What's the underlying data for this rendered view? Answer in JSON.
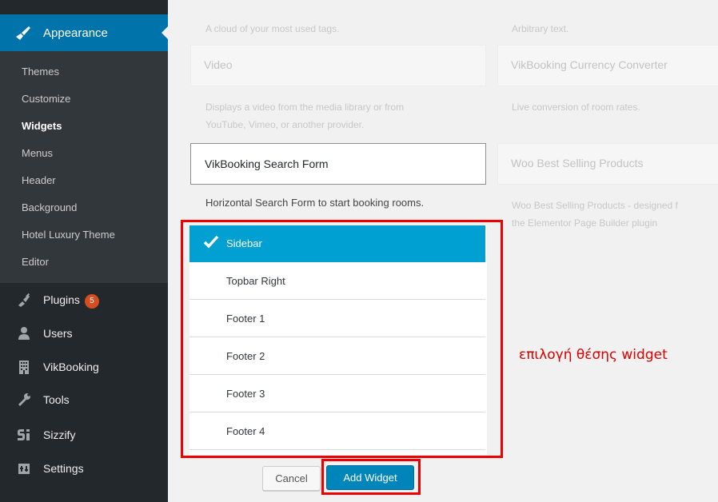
{
  "sidebar": {
    "appearance_label": "Appearance",
    "submenu": [
      "Themes",
      "Customize",
      "Widgets",
      "Menus",
      "Header",
      "Background",
      "Hotel Luxury Theme",
      "Editor"
    ],
    "active_submenu": "Widgets",
    "menu": {
      "plugins": {
        "label": "Plugins",
        "badge": "5"
      },
      "users": "Users",
      "vikbooking": "VikBooking",
      "tools": "Tools",
      "sizzify": "Sizzify",
      "settings": "Settings"
    },
    "colors": {
      "bg": "#23282d",
      "active": "#0073aa",
      "submenu_bg": "#32373c",
      "badge": "#d54e21"
    }
  },
  "widgets": {
    "left_column": {
      "tag_cloud_desc": "A cloud of your most used tags.",
      "video_title": "Video",
      "video_desc_line1": "Displays a video from the media library or from",
      "video_desc_line2": "YouTube, Vimeo, or another provider.",
      "search_form_title": "VikBooking Search Form",
      "search_form_desc": "Horizontal Search Form to start booking rooms."
    },
    "right_column": {
      "text_desc": "Arbitrary text.",
      "currency_title": "VikBooking Currency Converter",
      "currency_desc": "Live conversion of room rates.",
      "woo_title": "Woo Best Selling Products",
      "woo_desc_line1": "Woo Best Selling Products - designed f",
      "woo_desc_line2": "the Elementor Page Builder plugin"
    }
  },
  "chooser": {
    "areas": [
      "Sidebar",
      "Topbar Right",
      "Footer 1",
      "Footer 2",
      "Footer 3",
      "Footer 4"
    ],
    "selected": "Sidebar",
    "selected_color": "#00a0d2"
  },
  "buttons": {
    "cancel": "Cancel",
    "add_widget": "Add Widget"
  },
  "annotation": "επιλογή θέσης widget",
  "annotation_color": "#ee0000"
}
